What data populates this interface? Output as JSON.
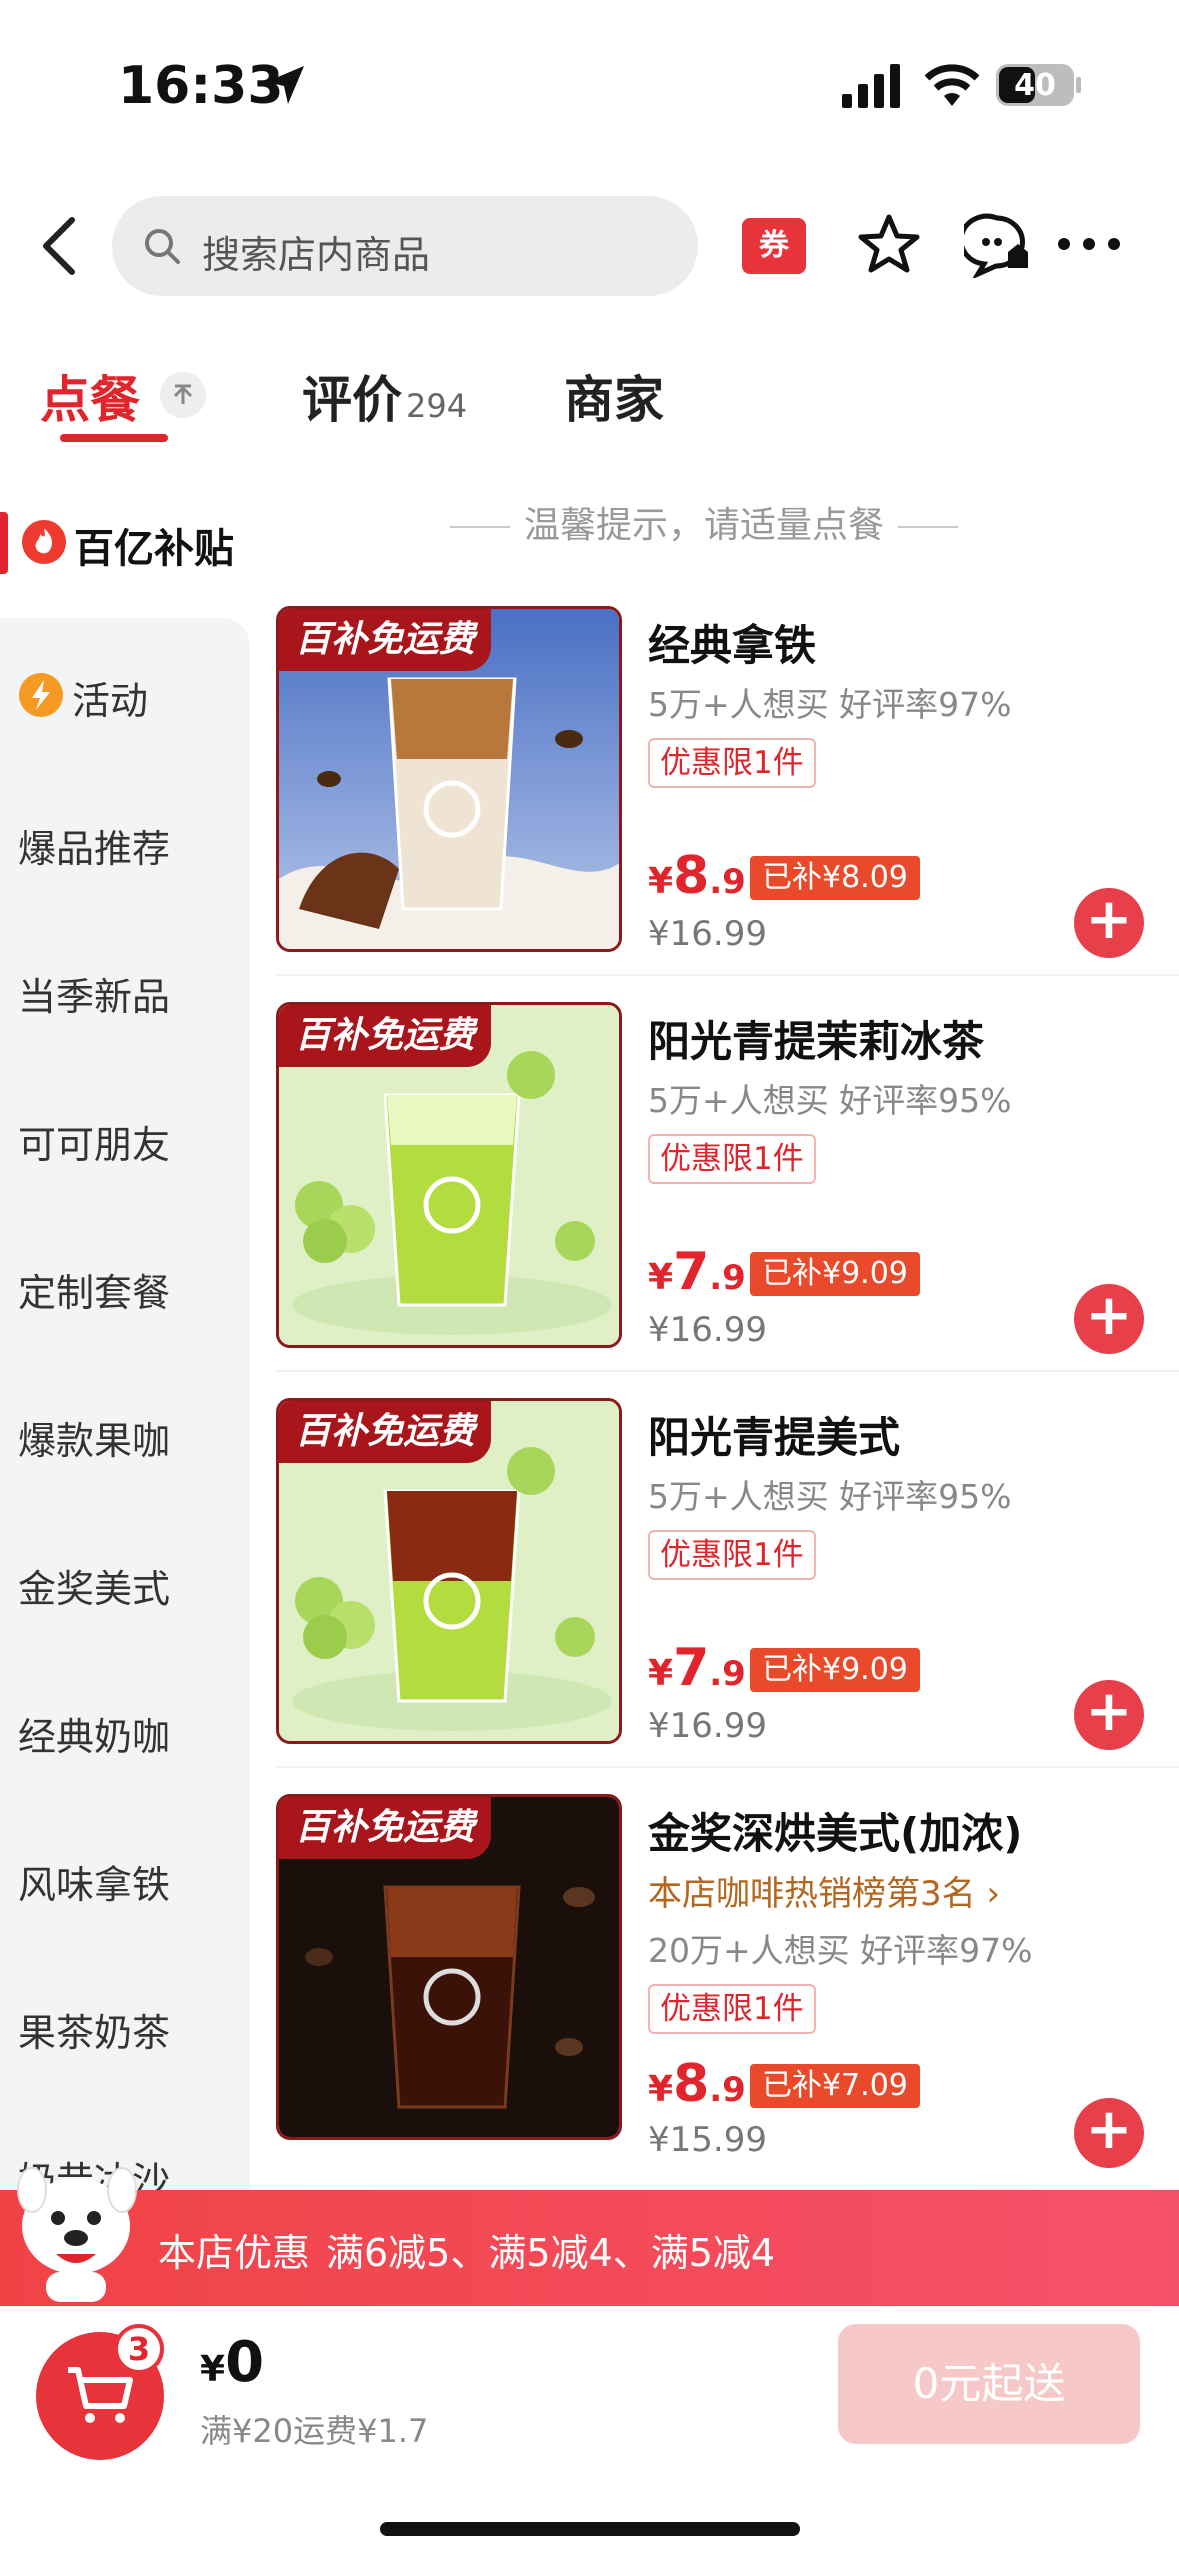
{
  "status_bar": {
    "time": "16:33",
    "battery": "40"
  },
  "header": {
    "search_placeholder": "搜索店内商品",
    "coupon_label": "券"
  },
  "tabs": [
    {
      "label": "点餐"
    },
    {
      "label": "评价",
      "count": "294"
    },
    {
      "label": "商家"
    }
  ],
  "sidebar": {
    "highlight_label": "百亿补贴",
    "items": [
      "活动",
      "爆品推荐",
      "当季新品",
      "可可朋友",
      "定制套餐",
      "爆款果咖",
      "金奖美式",
      "经典奶咖",
      "风味拿铁",
      "果茶奶茶",
      "奶昔冰沙"
    ]
  },
  "list_header": "温馨提示，请适量点餐",
  "products": [
    {
      "badge": "百补免运费",
      "name": "经典拿铁",
      "rank": "",
      "stats": "5万+人想买 好评率97%",
      "limit": "优惠限1件",
      "price_symbol": "¥",
      "price_int": "8",
      "price_dec": ".9",
      "subsidy": "已补¥8.09",
      "original": "¥16.99",
      "theme": "latte"
    },
    {
      "badge": "百补免运费",
      "name": "阳光青提茉莉冰茶",
      "rank": "",
      "stats": "5万+人想买 好评率95%",
      "limit": "优惠限1件",
      "price_symbol": "¥",
      "price_int": "7",
      "price_dec": ".9",
      "subsidy": "已补¥9.09",
      "original": "¥16.99",
      "theme": "grape"
    },
    {
      "badge": "百补免运费",
      "name": "阳光青提美式",
      "rank": "",
      "stats": "5万+人想买 好评率95%",
      "limit": "优惠限1件",
      "price_symbol": "¥",
      "price_int": "7",
      "price_dec": ".9",
      "subsidy": "已补¥9.09",
      "original": "¥16.99",
      "theme": "grape-americano"
    },
    {
      "badge": "百补免运费",
      "name": "金奖深烘美式(加浓)",
      "rank": "本店咖啡热销榜第3名 ›",
      "stats": "20万+人想买 好评率97%",
      "limit": "优惠限1件",
      "price_symbol": "¥",
      "price_int": "8",
      "price_dec": ".9",
      "subsidy": "已补¥7.09",
      "original": "¥15.99",
      "theme": "dark"
    }
  ],
  "promo_bar": {
    "title": "本店优惠",
    "details": "满6减5、满5减4、满5减4"
  },
  "cart": {
    "badge_count": "3",
    "total_symbol": "¥",
    "total": "0",
    "delivery_note": "满¥20运费¥1.7",
    "checkout_label": "0元起送"
  },
  "colors": {
    "accent": "#e0252c",
    "badge": "#a8161c",
    "subsidy": "#ea4a2c",
    "sidebar_bg": "#f3f4f6"
  }
}
